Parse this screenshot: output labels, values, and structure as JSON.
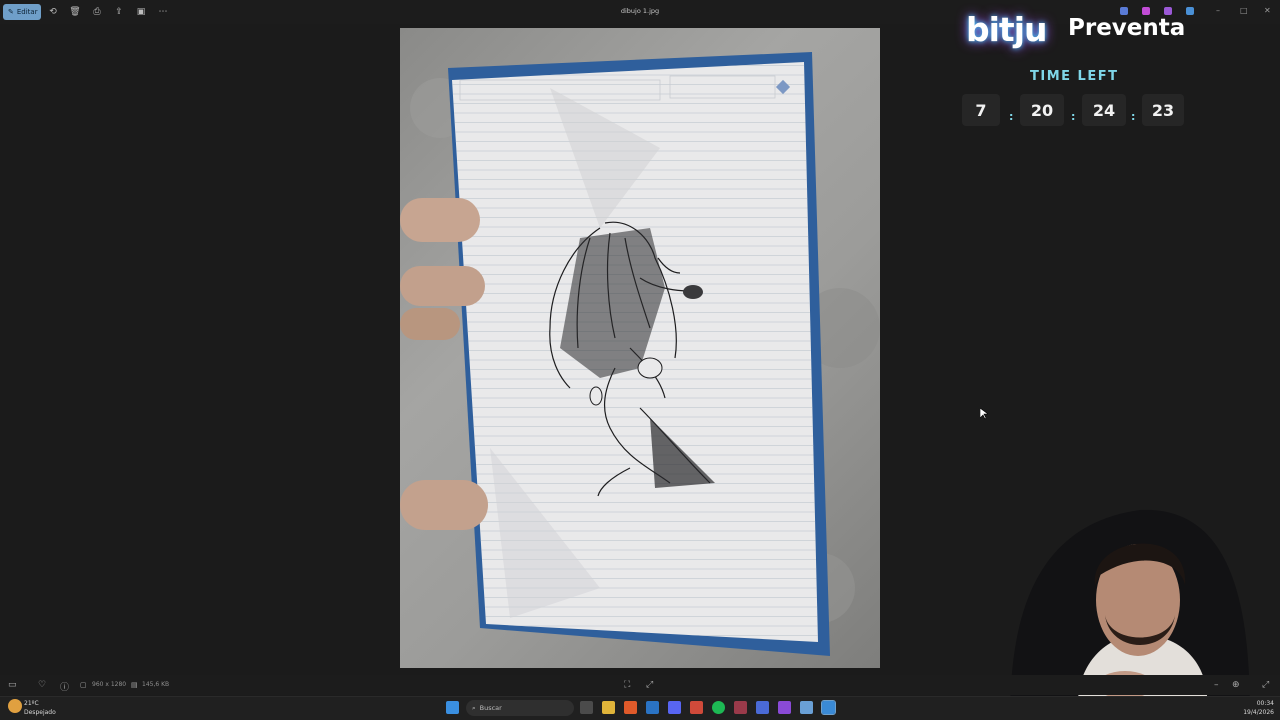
{
  "toolbar": {
    "edit_label": "Editar",
    "icons": [
      "rotate-icon",
      "delete-icon",
      "print-icon",
      "share-icon",
      "slideshow-icon",
      "more-icon"
    ]
  },
  "window": {
    "title": "dibujo 1.jpg"
  },
  "overlay": {
    "brand": "bitju",
    "brand_tagline": "Preventa",
    "time_left_label": "TIME LEFT",
    "countdown": [
      "7",
      "20",
      "24",
      "23"
    ],
    "separator": ":"
  },
  "info_bar": {
    "dimensions": "960 x 1280",
    "file_size": "145,6 KB"
  },
  "taskbar": {
    "search_placeholder": "Buscar",
    "weather_temp": "21ºC",
    "weather_desc": "Despejado",
    "time": "00:34",
    "date": "19/4/2026"
  },
  "colors": {
    "accent": "#6f9fc9",
    "countdown_accent": "#7fd6e8",
    "paper_border": "#2f5f9c"
  }
}
